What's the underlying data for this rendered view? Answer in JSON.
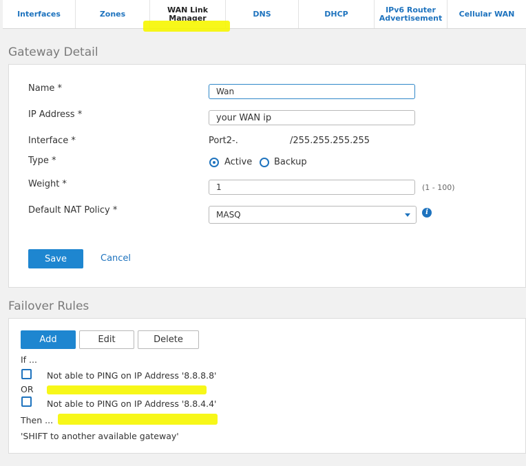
{
  "tabs": [
    {
      "label": "Interfaces"
    },
    {
      "label": "Zones"
    },
    {
      "label": "WAN Link Manager"
    },
    {
      "label": "DNS"
    },
    {
      "label": "DHCP"
    },
    {
      "label": "IPv6 Router Advertisement"
    },
    {
      "label": "Cellular WAN"
    }
  ],
  "gateway": {
    "section_title": "Gateway Detail",
    "name_label": "Name *",
    "name_value": "Wan",
    "ip_label": "IP Address *",
    "ip_value": "your WAN ip",
    "interface_label": "Interface *",
    "interface_value_prefix": "Port2-.",
    "interface_value_suffix": "/255.255.255.255",
    "type_label": "Type *",
    "type_active": "Active",
    "type_backup": "Backup",
    "weight_label": "Weight *",
    "weight_value": "1",
    "weight_range": "(1 - 100)",
    "nat_label": "Default NAT Policy *",
    "nat_value": "MASQ",
    "save_label": "Save",
    "cancel_label": "Cancel"
  },
  "failover": {
    "section_title": "Failover Rules",
    "add_label": "Add",
    "edit_label": "Edit",
    "delete_label": "Delete",
    "if_label": "If ...",
    "rule1": "Not able to PING on IP Address '8.8.8.8'",
    "or_label": "OR",
    "rule2": "Not able to PING on IP Address '8.8.4.4'",
    "then_label": "Then ...",
    "then_action": "'SHIFT to another available gateway'"
  },
  "colors": {
    "accent": "#1e86d0",
    "link": "#1e73be",
    "highlight": "#f6f600"
  }
}
